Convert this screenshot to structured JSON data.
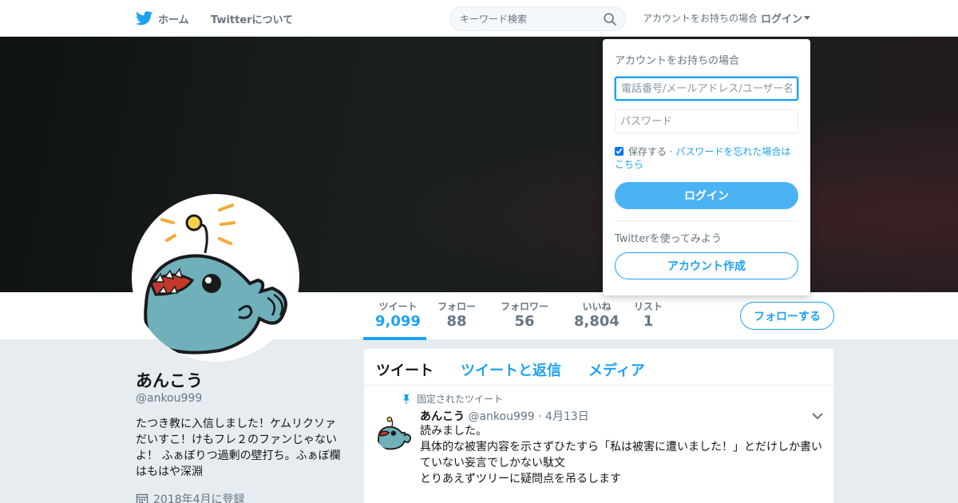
{
  "nav": {
    "home_label": "ホーム",
    "about_label": "Twitterについて",
    "search_placeholder": "キーワード検索",
    "login_prompt": "アカウントをお持ちの場合",
    "login_label": "ログイン"
  },
  "profile": {
    "name": "あんこう",
    "handle": "@ankou999",
    "bio": "たつき教に入信しました！ケムリクソァだいすこ！けもフレ２のファンじゃないよ！ ふぁぼりつ過剰の壁打ち。ふぁぼ欄はもはや深淵",
    "joined": "2018年4月に登録"
  },
  "stats": [
    {
      "label": "ツイート",
      "value": "9,099"
    },
    {
      "label": "フォロー",
      "value": "88"
    },
    {
      "label": "フォロワー",
      "value": "56"
    },
    {
      "label": "いいね",
      "value": "8,804"
    },
    {
      "label": "リスト",
      "value": "1"
    }
  ],
  "follow_label": "フォローする",
  "timeline": {
    "tabs": [
      "ツイート",
      "ツイートと返信",
      "メディア"
    ],
    "pinned_label": "固定されたツイート",
    "tweet": {
      "name": "あんこう",
      "handle": "@ankou999",
      "date": "· 4月13日",
      "lines": [
        "読みました。",
        "具体的な被害内容を示さずひたすら「私は被害に遭いました！」とだけしか書いていない妄言でしかない駄文",
        "とりあえずツリーに疑問点を吊るします"
      ]
    }
  },
  "login_dropdown": {
    "title": "アカウントをお持ちの場合",
    "username_placeholder": "電話番号/メールアドレス/ユーザー名",
    "password_placeholder": "パスワード",
    "remember_label": "保存する",
    "separator": "·",
    "forgot_link": "パスワードを忘れた場合はこちら",
    "login_button": "ログイン",
    "try_label": "Twitterを使ってみよう",
    "signup_button": "アカウント作成"
  },
  "colors": {
    "accent": "#1da1f2",
    "avatar_fish": "#6fb0ba",
    "bulb": "#f8d04a"
  },
  "icons": [
    "twitter-bird-icon",
    "search-icon",
    "caret-down-icon",
    "pin-icon",
    "calendar-icon",
    "chevron-down-icon"
  ]
}
